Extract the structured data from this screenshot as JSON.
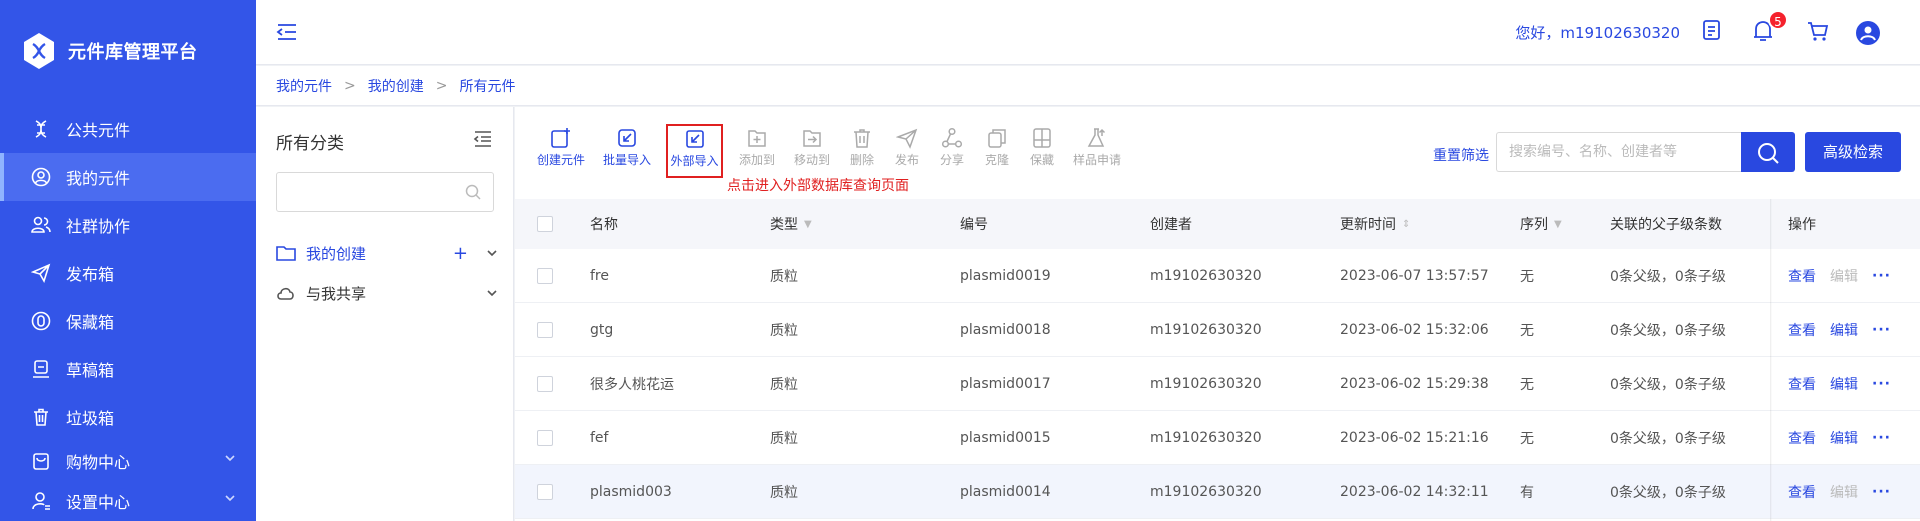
{
  "app": {
    "title": "元件库管理平台"
  },
  "colors": {
    "brand": "#3355e8",
    "accent": "#2948e0",
    "alert": "#e02020"
  },
  "sidebar": {
    "items": [
      {
        "label": "公共元件",
        "icon": "dna-icon"
      },
      {
        "label": "我的元件",
        "icon": "user-circle-icon",
        "active": true
      },
      {
        "label": "社群协作",
        "icon": "group-icon"
      },
      {
        "label": "发布箱",
        "icon": "send-icon"
      },
      {
        "label": "保藏箱",
        "icon": "vault-icon"
      },
      {
        "label": "草稿箱",
        "icon": "draft-icon"
      },
      {
        "label": "垃圾箱",
        "icon": "trash-icon"
      },
      {
        "label": "购物中心",
        "icon": "bag-icon",
        "expandable": true
      },
      {
        "label": "设置中心",
        "icon": "user-settings-icon",
        "expandable": true
      }
    ]
  },
  "header": {
    "greeting": "您好，m19102630320",
    "notifications": "5"
  },
  "breadcrumb": [
    "我的元件",
    "我的创建",
    "所有元件"
  ],
  "category": {
    "title": "所有分类",
    "search_placeholder": "",
    "items": [
      {
        "label": "我的创建",
        "active": true
      },
      {
        "label": "与我共享",
        "active": false
      }
    ]
  },
  "toolbar": {
    "tools": [
      {
        "label": "创建元件",
        "enabled": true
      },
      {
        "label": "批量导入",
        "enabled": true
      },
      {
        "label": "外部导入",
        "enabled": true,
        "highlight": true
      },
      {
        "label": "添加到",
        "enabled": false
      },
      {
        "label": "移动到",
        "enabled": false
      },
      {
        "label": "删除",
        "enabled": false
      },
      {
        "label": "发布",
        "enabled": false
      },
      {
        "label": "分享",
        "enabled": false
      },
      {
        "label": "克隆",
        "enabled": false
      },
      {
        "label": "保藏",
        "enabled": false
      },
      {
        "label": "样品申请",
        "enabled": false
      }
    ],
    "annotation": "点击进入外部数据库查询页面",
    "reset_filter": "重置筛选",
    "search_placeholder": "搜索编号、名称、创建者等",
    "advanced_search": "高级检索"
  },
  "table": {
    "columns": [
      "名称",
      "类型",
      "编号",
      "创建者",
      "更新时间",
      "序列",
      "关联的父子级条数",
      "操作"
    ],
    "rows": [
      {
        "name": "fre",
        "type": "质粒",
        "id": "plasmid0019",
        "creator": "m19102630320",
        "updated": "2023-06-07 13:57:57",
        "seq": "无",
        "relations": "0条父级，0条子级",
        "view": "查看",
        "edit": "编辑",
        "edit_enabled": false
      },
      {
        "name": "gtg",
        "type": "质粒",
        "id": "plasmid0018",
        "creator": "m19102630320",
        "updated": "2023-06-02 15:32:06",
        "seq": "无",
        "relations": "0条父级，0条子级",
        "view": "查看",
        "edit": "编辑",
        "edit_enabled": true
      },
      {
        "name": "很多人桃花运",
        "type": "质粒",
        "id": "plasmid0017",
        "creator": "m19102630320",
        "updated": "2023-06-02 15:29:38",
        "seq": "无",
        "relations": "0条父级，0条子级",
        "view": "查看",
        "edit": "编辑",
        "edit_enabled": true
      },
      {
        "name": "fef",
        "type": "质粒",
        "id": "plasmid0015",
        "creator": "m19102630320",
        "updated": "2023-06-02 15:21:16",
        "seq": "无",
        "relations": "0条父级，0条子级",
        "view": "查看",
        "edit": "编辑",
        "edit_enabled": true
      },
      {
        "name": "plasmid003",
        "type": "质粒",
        "id": "plasmid0014",
        "creator": "m19102630320",
        "updated": "2023-06-02 14:32:11",
        "seq": "有",
        "relations": "0条父级，0条子级",
        "view": "查看",
        "edit": "编辑",
        "edit_enabled": false
      }
    ]
  }
}
